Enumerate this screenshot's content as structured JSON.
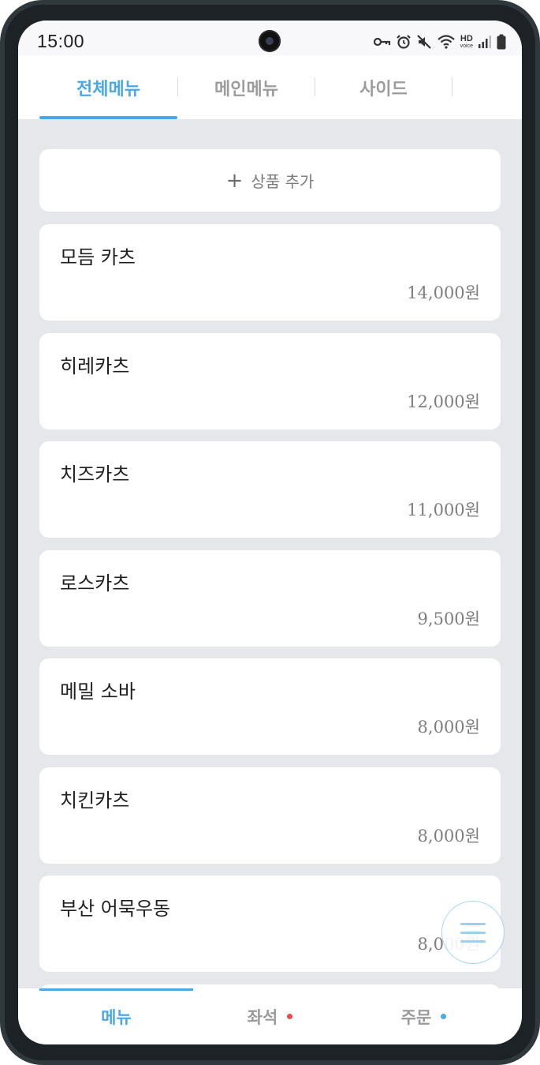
{
  "status_bar": {
    "time": "15:00",
    "icons": [
      "key-icon",
      "alarm-icon",
      "mute-icon",
      "wifi-icon",
      "hd-voice-icon",
      "signal-icon",
      "battery-icon"
    ],
    "hd_label": "HD",
    "voice_label": "voice"
  },
  "top_tabs": [
    {
      "label": "전체메뉴",
      "active": true
    },
    {
      "label": "메인메뉴",
      "active": false
    },
    {
      "label": "사이드",
      "active": false
    }
  ],
  "add_product": {
    "icon": "plus-icon",
    "label": "상품 추가"
  },
  "menu_items": [
    {
      "name": "모듬 카츠",
      "price": "14,000원"
    },
    {
      "name": "히레카츠",
      "price": "12,000원"
    },
    {
      "name": "치즈카츠",
      "price": "11,000원"
    },
    {
      "name": "로스카츠",
      "price": "9,500원"
    },
    {
      "name": "메밀 소바",
      "price": "8,000원"
    },
    {
      "name": "치킨카츠",
      "price": "8,000원"
    },
    {
      "name": "부산 어묵우동",
      "price": "8,000원"
    }
  ],
  "fab": {
    "icon": "hamburger-menu-icon"
  },
  "bottom_nav": [
    {
      "label": "메뉴",
      "active": true,
      "dot": null
    },
    {
      "label": "좌석",
      "active": false,
      "dot": "#e94b4b"
    },
    {
      "label": "주문",
      "active": false,
      "dot": "#4aa8e8"
    }
  ],
  "colors": {
    "accent": "#4aa8e8",
    "background": "#e6e7eb",
    "card": "#ffffff",
    "seat_dot": "#e94b4b",
    "order_dot": "#4aa8e8"
  }
}
